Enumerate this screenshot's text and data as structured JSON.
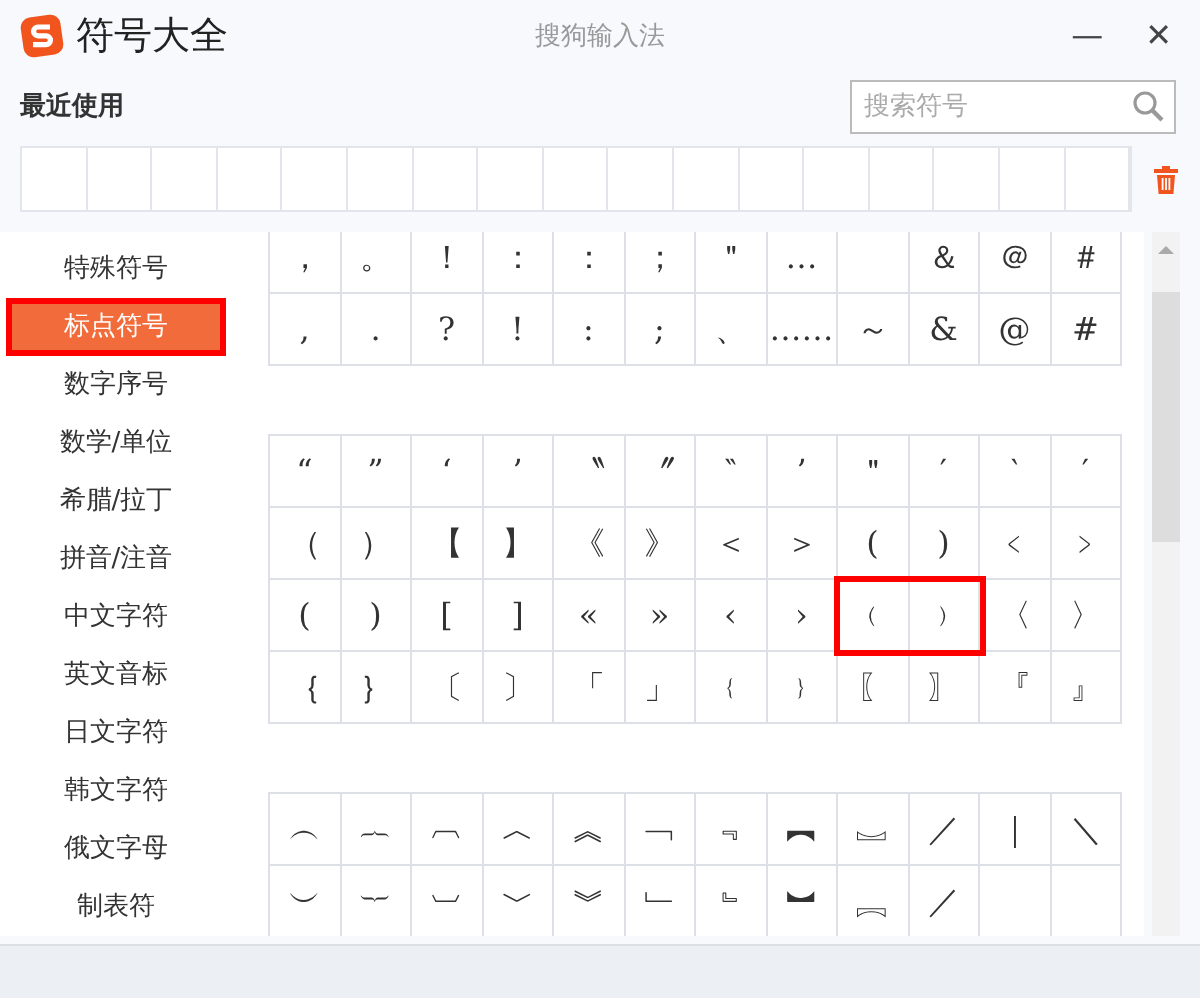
{
  "window": {
    "title": "符号大全",
    "app_name": "搜狗输入法",
    "minimize": "—",
    "close": "✕"
  },
  "recent": {
    "label": "最近使用"
  },
  "search": {
    "placeholder": "搜索符号"
  },
  "sidebar": {
    "items": [
      {
        "label": "特殊符号",
        "selected": false,
        "highlighted": false
      },
      {
        "label": "标点符号",
        "selected": true,
        "highlighted": true
      },
      {
        "label": "数字序号",
        "selected": false,
        "highlighted": false
      },
      {
        "label": "数学/单位",
        "selected": false,
        "highlighted": false
      },
      {
        "label": "希腊/拉丁",
        "selected": false,
        "highlighted": false
      },
      {
        "label": "拼音/注音",
        "selected": false,
        "highlighted": false
      },
      {
        "label": "中文字符",
        "selected": false,
        "highlighted": false
      },
      {
        "label": "英文音标",
        "selected": false,
        "highlighted": false
      },
      {
        "label": "日文字符",
        "selected": false,
        "highlighted": false
      },
      {
        "label": "韩文字符",
        "selected": false,
        "highlighted": false
      },
      {
        "label": "俄文字母",
        "selected": false,
        "highlighted": false
      },
      {
        "label": "制表符",
        "selected": false,
        "highlighted": false
      }
    ]
  },
  "groups": [
    {
      "rows": [
        {
          "cells": [
            "，",
            "。",
            "！",
            "：",
            "：",
            "；",
            "＂",
            "…",
            "",
            "＆",
            "＠",
            "＃"
          ]
        },
        {
          "cells": [
            ",",
            ".",
            "?",
            "!",
            ":",
            ";",
            "、",
            "……",
            "～",
            "&",
            "@",
            "#"
          ]
        }
      ]
    },
    {
      "rows": [
        {
          "cells": [
            "“",
            "”",
            "‘",
            "’",
            "〝",
            "〞",
            "‶",
            "’",
            "＂",
            "′",
            "‵",
            "′"
          ]
        },
        {
          "cells": [
            "（",
            "）",
            "【",
            "】",
            "《",
            "》",
            "＜",
            "＞",
            "(",
            ")",
            "﹤",
            "﹥"
          ]
        },
        {
          "cells": [
            "(",
            ")",
            "[",
            "]",
            "«",
            "»",
            "‹",
            "›",
            {
              "text": "﹙",
              "highlighted": true
            },
            {
              "text": "﹚",
              "highlighted": true
            },
            "〈",
            "〉"
          ]
        },
        {
          "cells": [
            "｛",
            "｝",
            "〔",
            "〕",
            "「",
            "」",
            "﹛",
            "﹜",
            "〖",
            "〗",
            "『",
            "』"
          ]
        }
      ]
    },
    {
      "rows": [
        {
          "cells": [
            "︵",
            "︷",
            "︹",
            "︿",
            "︽",
            "﹁",
            "﹃",
            "︻",
            "︗",
            "／",
            "｜",
            "＼"
          ]
        },
        {
          "cells": [
            "︶",
            "︸",
            "︺",
            "﹀",
            "︾",
            "﹂",
            "﹄",
            "︼",
            "︘",
            "／",
            "",
            ""
          ]
        }
      ]
    }
  ]
}
